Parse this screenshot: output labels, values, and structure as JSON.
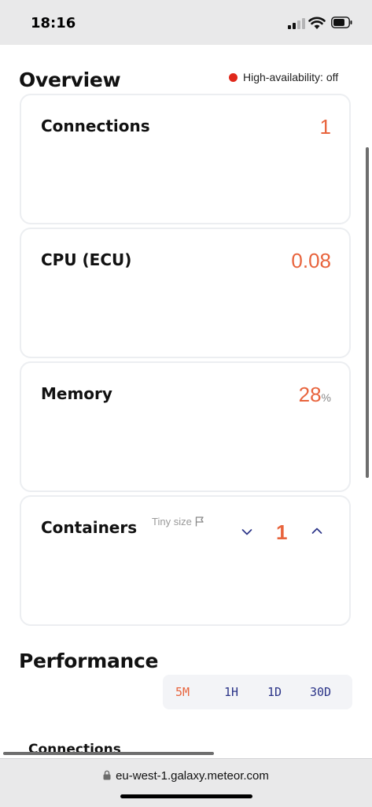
{
  "status_bar": {
    "time": "18:16"
  },
  "overview": {
    "title": "Overview",
    "high_availability": "High-availability: off",
    "cards": {
      "connections": {
        "title": "Connections",
        "value": "1"
      },
      "cpu": {
        "title": "CPU (ECU)",
        "value": "0.08"
      },
      "memory": {
        "title": "Memory",
        "value": "28",
        "unit": "%"
      },
      "containers": {
        "title": "Containers",
        "tag": "Tiny size",
        "value": "1"
      }
    }
  },
  "performance": {
    "title": "Performance",
    "ranges": [
      "5M",
      "1H",
      "1D",
      "30D"
    ],
    "active_range": "5M",
    "first_chart_title": "Connections"
  },
  "browser": {
    "url": "eu-west-1.galaxy.meteor.com"
  },
  "colors": {
    "accent": "#e8643d",
    "range_text": "#2b3488",
    "status_off": "#e0281b"
  }
}
